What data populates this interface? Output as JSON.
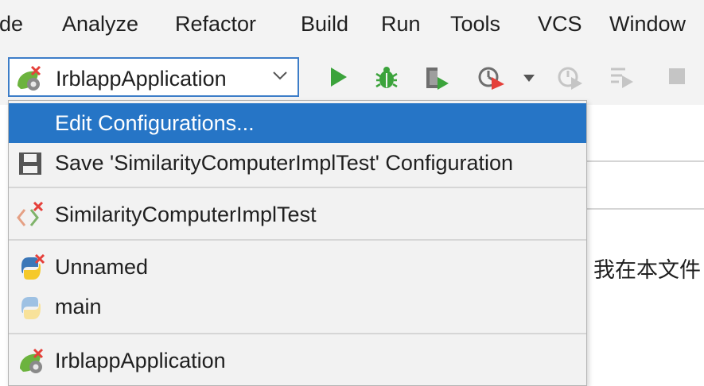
{
  "menu": {
    "items": [
      {
        "label": "de"
      },
      {
        "label": "Analyze"
      },
      {
        "label": "Refactor"
      },
      {
        "label": "Build"
      },
      {
        "label": "Run"
      },
      {
        "label": "Tools"
      },
      {
        "label": "VCS"
      },
      {
        "label": "Window"
      }
    ]
  },
  "toolbar": {
    "run_config": {
      "label": "IrblappApplication",
      "icon": "spring-boot-error-icon"
    },
    "icons": [
      "run-icon",
      "debug-icon",
      "coverage-icon",
      "profile-icon",
      "profile-dropdown-icon",
      "attach-debugger-icon",
      "run-to-cursor-icon",
      "stop-icon"
    ]
  },
  "dropdown": {
    "items": [
      {
        "label": "Edit Configurations...",
        "selected": true
      },
      {
        "label": "Save 'SimilarityComputerImplTest' Configuration",
        "icon": "save-icon"
      },
      {
        "label": "SimilarityComputerImplTest",
        "icon": "junit-test-error-icon"
      },
      {
        "label": "Unnamed",
        "icon": "python-error-icon"
      },
      {
        "label": "main",
        "icon": "python-icon"
      },
      {
        "label": "IrblappApplication",
        "icon": "spring-boot-error-icon"
      }
    ]
  },
  "editor": {
    "text": "我在本文件"
  },
  "colors": {
    "selection": "#2675c6",
    "accent_border": "#3d7dc8",
    "run_green": "#3ba33b",
    "error_red": "#e5403a"
  }
}
